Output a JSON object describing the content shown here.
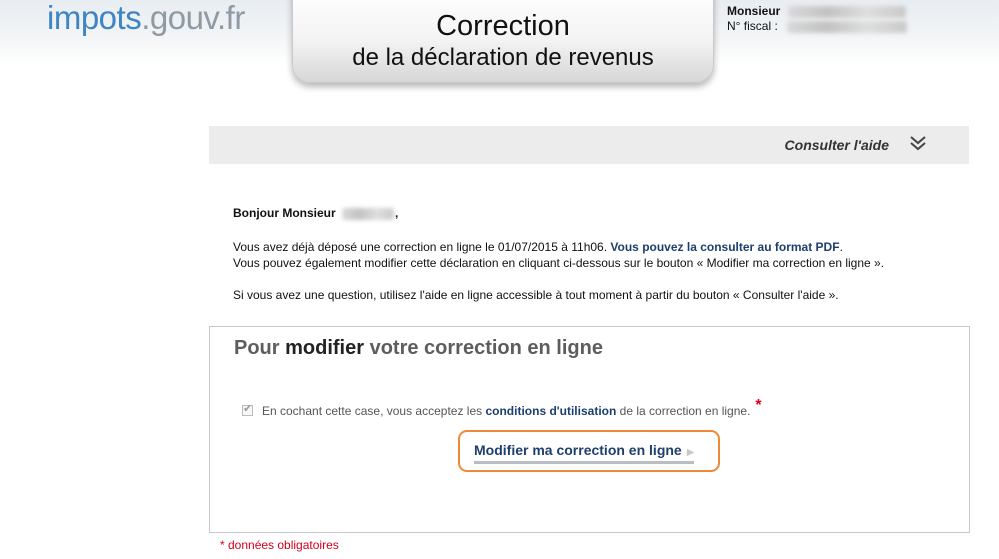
{
  "header": {
    "logo_part1": "impots",
    "logo_part2": ".gouv.fr",
    "title_line1": "Correction",
    "title_line2": "de la déclaration de revenus",
    "user_title": "Monsieur",
    "fiscal_label": "N° fiscal :"
  },
  "help": {
    "label": "Consulter l'aide",
    "icon": "double-chevron-down-icon"
  },
  "message": {
    "greeting": "Bonjour Monsieur",
    "greeting_end": ",",
    "p1_text": "Vous avez déjà déposé une correction en ligne le 01/07/2015 à 11h06. ",
    "p1_link": "Vous pouvez la consulter au format PDF",
    "p1_end": ".",
    "p1_line2": "Vous pouvez également modifier cette déclaration en cliquant ci-dessous sur le bouton « Modifier ma correction en ligne ».",
    "p2": "Si vous avez une question, utilisez l'aide en ligne accessible à tout moment à partir du bouton « Consulter l'aide »."
  },
  "panel": {
    "title_pre": "Pour ",
    "title_em": "modifier",
    "title_post": " votre correction en ligne",
    "consent_pre": "En cochant cette case, vous acceptez les ",
    "consent_link": "conditions d'utilisation",
    "consent_post": " de la correction en ligne.",
    "required_mark": "*",
    "checkbox_checked": true,
    "button_label": "Modifier ma correction en ligne"
  },
  "footer": {
    "mandatory_note": "* données obligatoires"
  },
  "colors": {
    "logo_blue": "#3f85c2",
    "link_blue": "#1d3f6e",
    "button_border_orange": "#ec8a37",
    "required_red": "#d1001b"
  }
}
